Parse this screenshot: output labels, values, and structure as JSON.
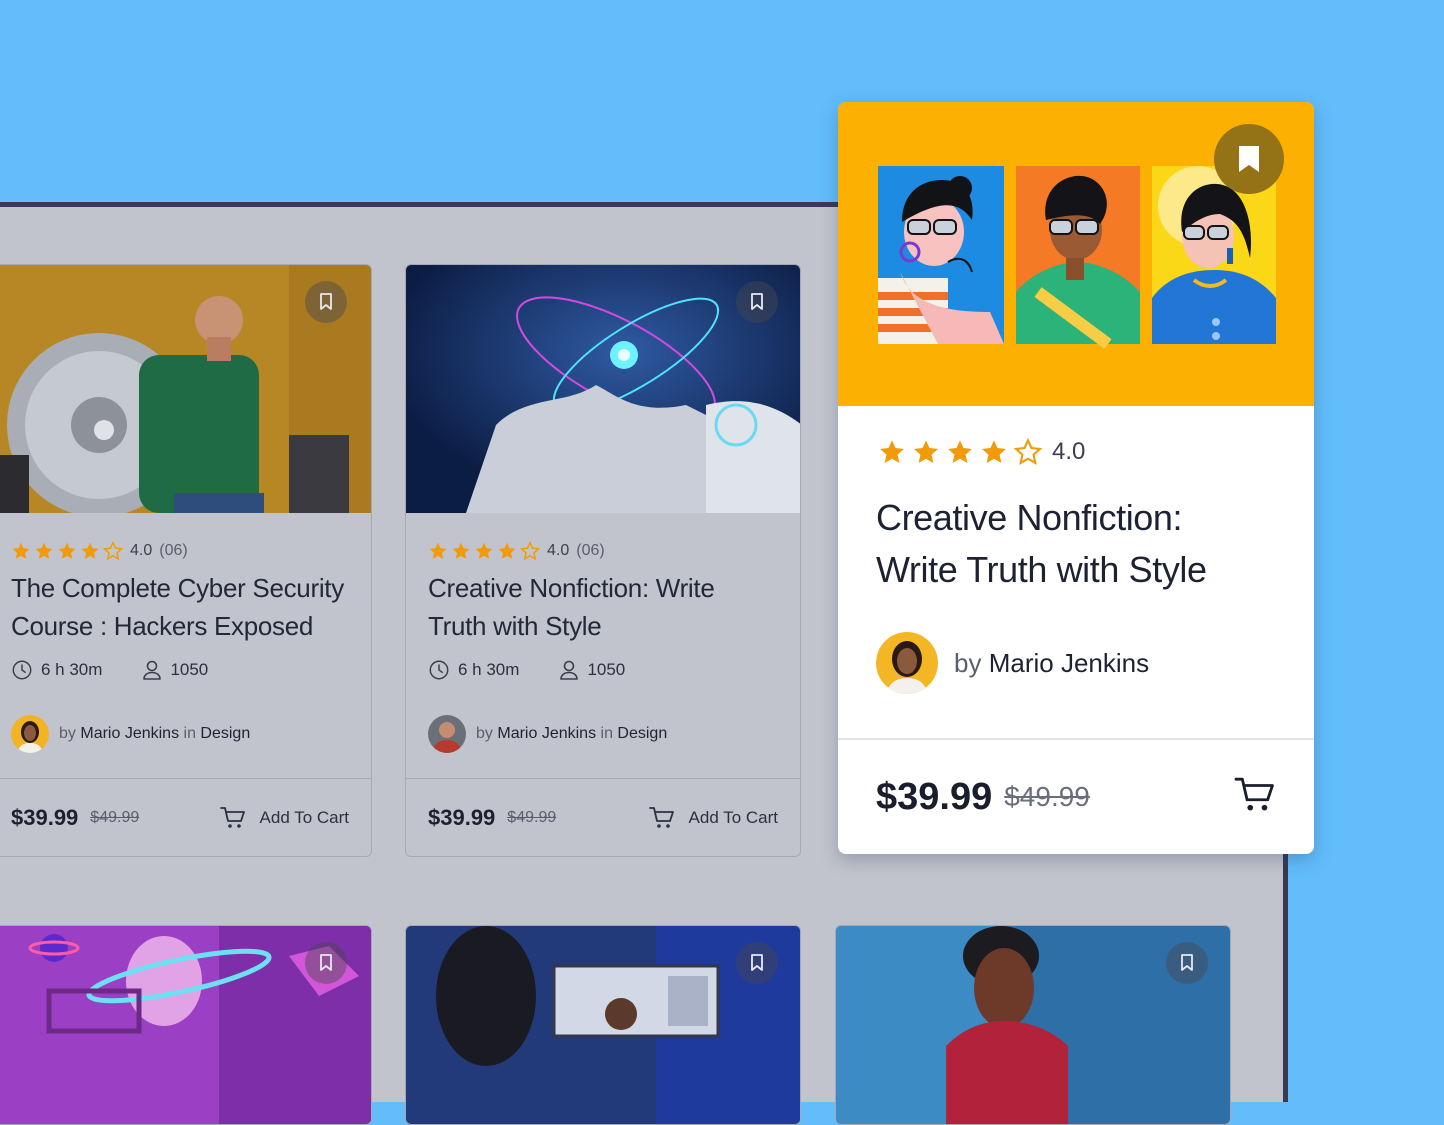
{
  "colors": {
    "background": "#63bdfb",
    "panel": "#c2c4cd",
    "star": "#f29b0a",
    "feature_hero": "#fcb002"
  },
  "courses": [
    {
      "rating": "4.0",
      "count": "(06)",
      "title_line1": "The Complete Cyber Security",
      "title_line2": "Course : Hackers Exposed",
      "duration": "6 h 30m",
      "students": "1050",
      "by": "by",
      "author": "Mario Jenkins",
      "in": "in",
      "category": "Design",
      "price": "$39.99",
      "old_price": "$49.99",
      "cart_label": "Add To Cart"
    },
    {
      "rating": "4.0",
      "count": "(06)",
      "title_line1": "Creative Nonfiction: Write",
      "title_line2": "Truth with Style",
      "duration": "6 h 30m",
      "students": "1050",
      "by": "by",
      "author": "Mario Jenkins",
      "in": "in",
      "category": "Design",
      "price": "$39.99",
      "old_price": "$49.99",
      "cart_label": "Add To Cart"
    }
  ],
  "feature": {
    "rating": "4.0",
    "title_line1": "Creative Nonfiction:",
    "title_line2": "Write Truth with Style",
    "by": "by",
    "author": "Mario Jenkins",
    "price": "$39.99",
    "old_price": "$49.99"
  },
  "icons": {
    "star": "star-icon",
    "star_outline": "star-outline-icon",
    "clock": "clock-icon",
    "user": "user-icon",
    "cart": "cart-icon",
    "bookmark": "bookmark-icon"
  }
}
